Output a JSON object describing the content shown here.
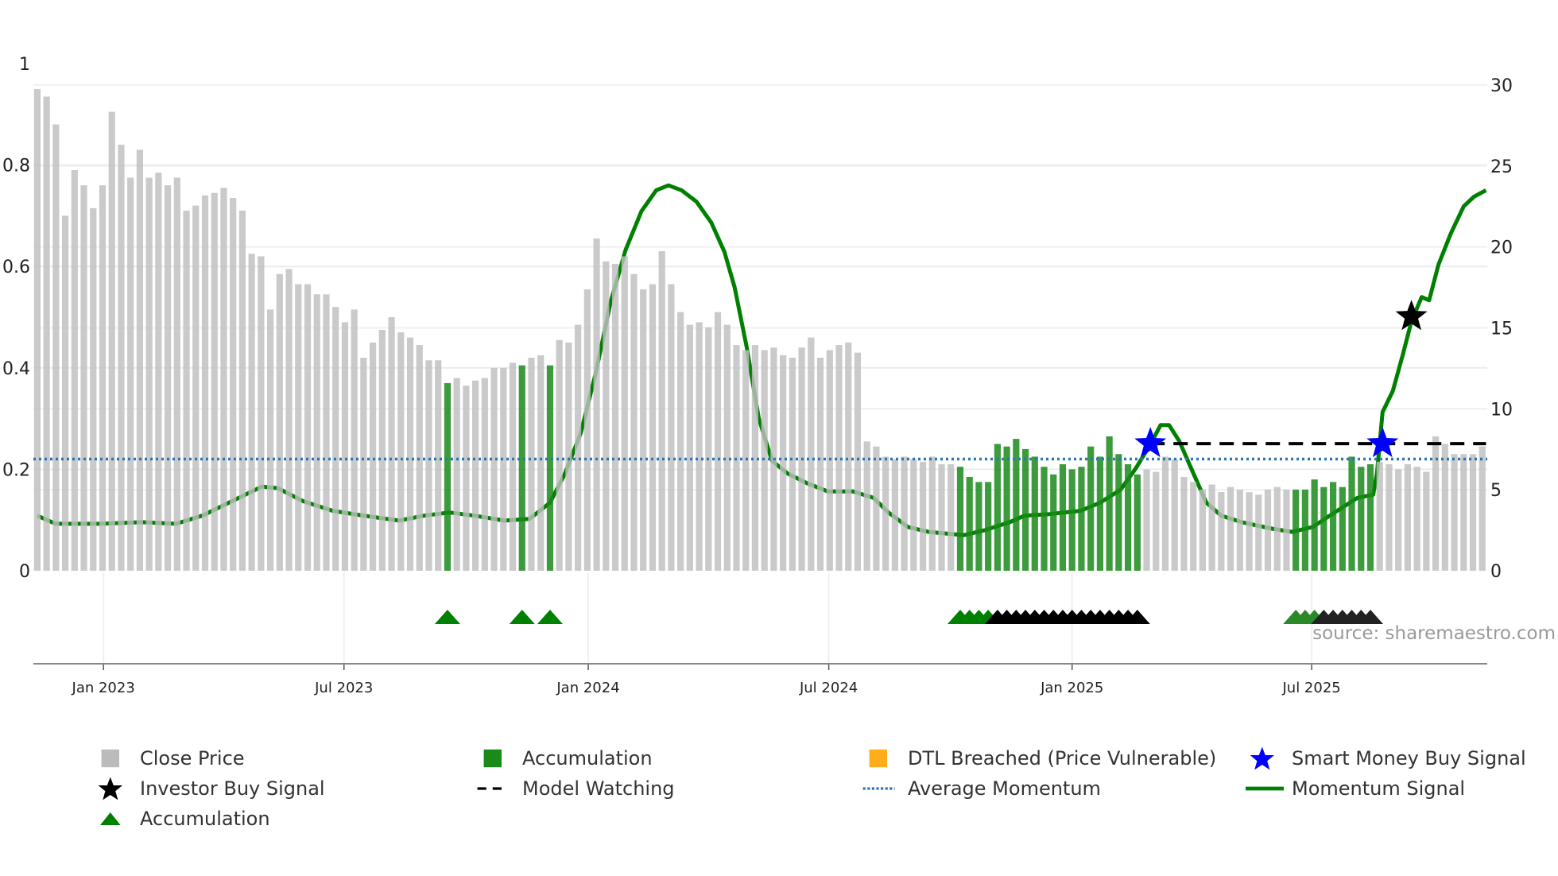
{
  "chart_data": {
    "type": "bar",
    "title": "",
    "x_unit": "week index",
    "left_axis": {
      "ylim": [
        0,
        1
      ],
      "ticks": [
        "0",
        "0.2",
        "0.4",
        "0.6",
        "0.8",
        "1"
      ],
      "tick_values": [
        0,
        0.2,
        0.4,
        0.6,
        0.8,
        1
      ]
    },
    "right_axis": {
      "ylim": [
        0,
        30
      ],
      "ticks": [
        "0",
        "5",
        "10",
        "15",
        "20",
        "25",
        "30"
      ],
      "tick_values": [
        0,
        5,
        10,
        15,
        20,
        25,
        30
      ]
    },
    "x_ticks": [
      {
        "label": "Jan 2023",
        "week": 7.1
      },
      {
        "label": "Jul 2023",
        "week": 32.9
      },
      {
        "label": "Jan 2024",
        "week": 59.1
      },
      {
        "label": "Jul 2024",
        "week": 84.9
      },
      {
        "label": "Jan 2025",
        "week": 111.0
      },
      {
        "label": "Jul 2025",
        "week": 136.7
      }
    ],
    "close_price": [
      0.95,
      0.935,
      0.88,
      0.7,
      0.79,
      0.76,
      0.715,
      0.76,
      0.905,
      0.84,
      0.775,
      0.83,
      0.775,
      0.785,
      0.76,
      0.775,
      0.71,
      0.72,
      0.74,
      0.745,
      0.755,
      0.735,
      0.71,
      0.625,
      0.62,
      0.515,
      0.585,
      0.595,
      0.565,
      0.565,
      0.545,
      0.545,
      0.52,
      0.49,
      0.515,
      0.42,
      0.45,
      0.475,
      0.5,
      0.47,
      0.46,
      0.445,
      0.415,
      0.415,
      0.37,
      0.38,
      0.365,
      0.375,
      0.38,
      0.4,
      0.4,
      0.41,
      0.405,
      0.42,
      0.425,
      0.405,
      0.455,
      0.45,
      0.485,
      0.555,
      0.655,
      0.61,
      0.605,
      0.62,
      0.585,
      0.555,
      0.565,
      0.63,
      0.565,
      0.51,
      0.485,
      0.49,
      0.48,
      0.51,
      0.485,
      0.445,
      0.435,
      0.445,
      0.435,
      0.44,
      0.425,
      0.42,
      0.44,
      0.46,
      0.42,
      0.435,
      0.445,
      0.45,
      0.43,
      0.255,
      0.245,
      0.225,
      0.22,
      0.225,
      0.22,
      0.215,
      0.225,
      0.21,
      0.21,
      0.205,
      0.185,
      0.175,
      0.175,
      0.25,
      0.245,
      0.26,
      0.24,
      0.225,
      0.205,
      0.19,
      0.21,
      0.2,
      0.205,
      0.245,
      0.225,
      0.265,
      0.23,
      0.21,
      0.19,
      0.2,
      0.195,
      0.225,
      0.22,
      0.185,
      0.175,
      0.16,
      0.17,
      0.155,
      0.165,
      0.16,
      0.155,
      0.15,
      0.16,
      0.165,
      0.16,
      0.16,
      0.16,
      0.18,
      0.165,
      0.175,
      0.165,
      0.225,
      0.205,
      0.21,
      0.215,
      0.21,
      0.2,
      0.21,
      0.205,
      0.195,
      0.265,
      0.25,
      0.23,
      0.23,
      0.23,
      0.245
    ],
    "accumulation_indices": [
      44,
      52,
      55,
      99,
      100,
      101,
      102,
      103,
      104,
      105,
      106,
      107,
      108,
      109,
      110,
      111,
      112,
      113,
      114,
      115,
      116,
      117,
      118,
      135,
      136,
      137,
      138,
      139,
      140,
      141,
      142,
      143
    ],
    "accumulation_triangles": {
      "green": [
        44,
        52,
        55,
        99,
        100,
        101,
        102,
        135,
        136,
        137
      ],
      "black": [
        103,
        104,
        105,
        106,
        107,
        108,
        109,
        110,
        111,
        112,
        113,
        114,
        115,
        116,
        117,
        118,
        138,
        139,
        140,
        141,
        142,
        143
      ]
    },
    "momentum_signal": [
      [
        0,
        3.4
      ],
      [
        1.95,
        2.9
      ],
      [
        6.8,
        2.9
      ],
      [
        11.2,
        3.0
      ],
      [
        14.9,
        2.9
      ],
      [
        17.7,
        3.4
      ],
      [
        20.9,
        4.3
      ],
      [
        24.1,
        5.2
      ],
      [
        25.8,
        5.1
      ],
      [
        28.5,
        4.3
      ],
      [
        31.7,
        3.7
      ],
      [
        35,
        3.4
      ],
      [
        38.8,
        3.1
      ],
      [
        41.5,
        3.4
      ],
      [
        44.2,
        3.6
      ],
      [
        46.9,
        3.4
      ],
      [
        50.1,
        3.1
      ],
      [
        52.8,
        3.2
      ],
      [
        55,
        4.2
      ],
      [
        56.6,
        6.0
      ],
      [
        58.3,
        8.5
      ],
      [
        59.9,
        12.2
      ],
      [
        61.5,
        16.6
      ],
      [
        63.1,
        19.8
      ],
      [
        64.8,
        22.2
      ],
      [
        66.4,
        23.5
      ],
      [
        67.7,
        23.8
      ],
      [
        69.1,
        23.5
      ],
      [
        70.7,
        22.8
      ],
      [
        72.3,
        21.5
      ],
      [
        73.7,
        19.7
      ],
      [
        74.8,
        17.5
      ],
      [
        76.1,
        13.8
      ],
      [
        77.4,
        9.4
      ],
      [
        78.8,
        6.8
      ],
      [
        80.5,
        6.0
      ],
      [
        82.6,
        5.4
      ],
      [
        84.8,
        4.9
      ],
      [
        87.5,
        4.9
      ],
      [
        89.7,
        4.5
      ],
      [
        91.3,
        3.6
      ],
      [
        93.4,
        2.7
      ],
      [
        95.6,
        2.4
      ],
      [
        99.4,
        2.2
      ],
      [
        101.6,
        2.5
      ],
      [
        104.3,
        3.0
      ],
      [
        105.9,
        3.4
      ],
      [
        108.6,
        3.5
      ],
      [
        111.9,
        3.7
      ],
      [
        114,
        4.2
      ],
      [
        116.2,
        5.0
      ],
      [
        117.8,
        6.3
      ],
      [
        119.4,
        7.8
      ],
      [
        120.5,
        9.0
      ],
      [
        121.4,
        9.0
      ],
      [
        122.5,
        8.0
      ],
      [
        123.8,
        6.3
      ],
      [
        125.4,
        4.2
      ],
      [
        127,
        3.4
      ],
      [
        129.2,
        3.0
      ],
      [
        132.4,
        2.6
      ],
      [
        134.6,
        2.4
      ],
      [
        136.8,
        2.7
      ],
      [
        138.9,
        3.5
      ],
      [
        141.6,
        4.5
      ],
      [
        143.3,
        4.7
      ],
      [
        143.7,
        6.0
      ],
      [
        144.3,
        9.8
      ],
      [
        145.4,
        11.1
      ],
      [
        146.5,
        13.4
      ],
      [
        147.4,
        15.4
      ],
      [
        148.5,
        16.9
      ],
      [
        149.3,
        16.7
      ],
      [
        150.3,
        18.9
      ],
      [
        151.6,
        20.8
      ],
      [
        153,
        22.5
      ],
      [
        154.1,
        23.1
      ],
      [
        155.4,
        23.5
      ]
    ],
    "average_momentum": 6.9,
    "model_watching": {
      "level": 7.85,
      "from_week": 119.4,
      "to_week": 155.4
    },
    "smart_money_buy_signals": [
      [
        119.4,
        7.85
      ],
      [
        144.3,
        7.85
      ]
    ],
    "investor_buy_signals": [
      [
        147.4,
        15.7
      ]
    ],
    "colors": {
      "close": "#bbbbbb",
      "accumulation": "#1a8a1a",
      "momentum": "#008000",
      "avg": "#2e75b6",
      "smart": "#0000ff",
      "investor": "#000000",
      "dtl": "#ffae1a"
    },
    "source": "source: sharemaestro.com",
    "legend": [
      {
        "label": "Close Price",
        "marker": "gray-square"
      },
      {
        "label": "Accumulation",
        "marker": "green-square"
      },
      {
        "label": "DTL Breached (Price Vulnerable)",
        "marker": "orange-square"
      },
      {
        "label": "Smart Money Buy Signal",
        "marker": "blue-star"
      },
      {
        "label": "Investor Buy Signal",
        "marker": "black-star"
      },
      {
        "label": "Model Watching",
        "marker": "black-dashed-line"
      },
      {
        "label": "Average Momentum",
        "marker": "blue-dotted-line"
      },
      {
        "label": "Momentum Signal",
        "marker": "green-line"
      },
      {
        "label": "Accumulation",
        "marker": "green-triangle"
      }
    ]
  }
}
